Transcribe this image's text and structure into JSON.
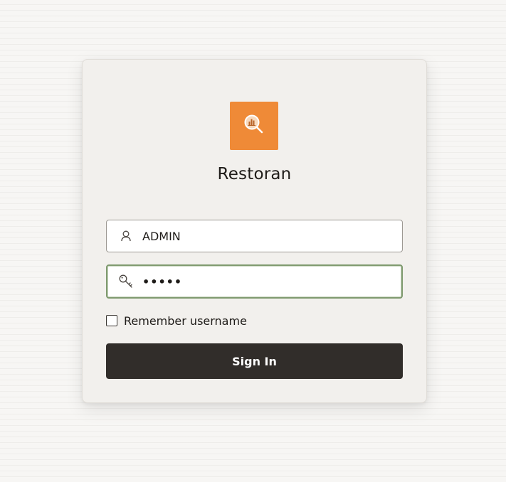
{
  "app": {
    "title": "Restoran",
    "logo_icon": "search-chart-icon",
    "logo_color": "#ef8a37"
  },
  "login": {
    "username": {
      "value": "ADMIN",
      "icon": "user-icon"
    },
    "password": {
      "value": "•••••",
      "icon": "key-icon",
      "focus_color": "#7f9a6f"
    },
    "remember": {
      "label": "Remember username",
      "checked": false
    },
    "signin_label": "Sign In",
    "signin_color": "#312d2a"
  }
}
